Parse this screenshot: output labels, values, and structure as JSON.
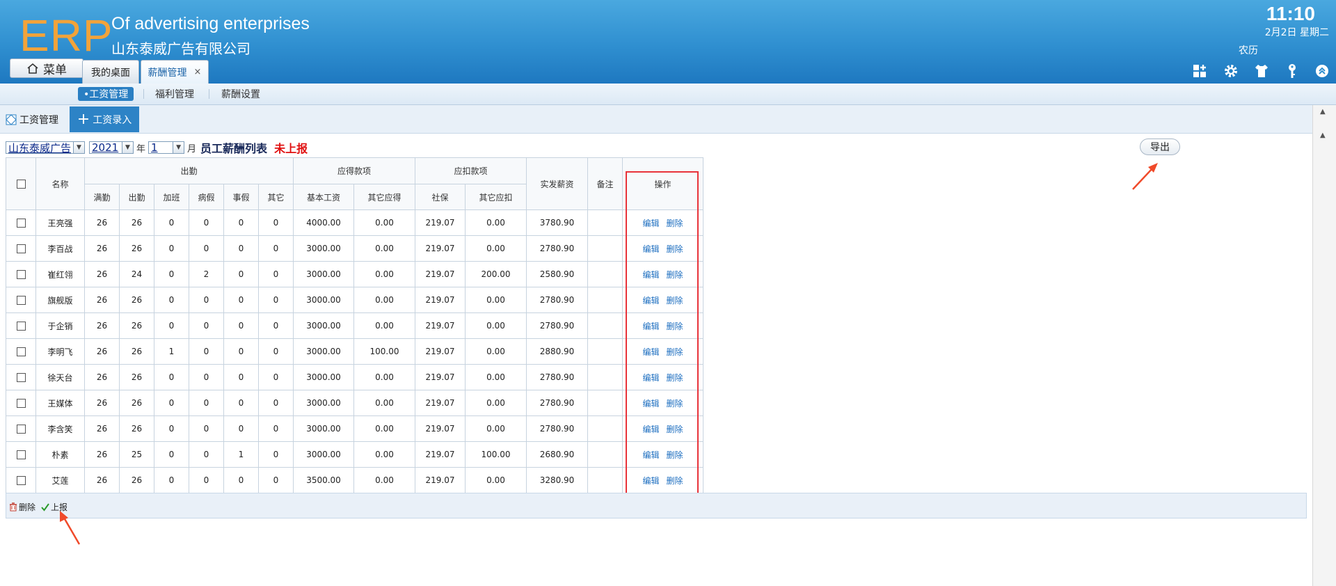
{
  "header": {
    "logo": "ERP",
    "company_en": "Of advertising enterprises",
    "company_cn": "山东泰威广告有限公司",
    "time": "11:10",
    "date": "2月2日 星期二",
    "lunar": "农历",
    "menu_label": "菜单",
    "tabs": [
      {
        "label": "我的桌面"
      },
      {
        "label": "薪酬管理",
        "close": "×"
      }
    ]
  },
  "subnav": {
    "items": [
      {
        "label": "•工资管理"
      },
      {
        "label": "福利管理"
      },
      {
        "label": "薪酬设置"
      }
    ]
  },
  "toolbar": {
    "title": "工资管理",
    "add_button": "工资录入"
  },
  "filter": {
    "company": "山东泰威广告",
    "year": "2021",
    "year_unit": "年",
    "month": "1",
    "month_unit": "月",
    "list_title": "员工薪酬列表",
    "status": "未上报",
    "export_button": "导出"
  },
  "table": {
    "headers": {
      "name": "名称",
      "attendance_group": "出勤",
      "payable_group": "应得款项",
      "deduction_group": "应扣款项",
      "net_pay": "实发薪资",
      "remark": "备注",
      "actions": "操作",
      "full_attendance": "满勤",
      "attendance": "出勤",
      "overtime": "加班",
      "sick_leave": "病假",
      "personal_leave": "事假",
      "other": "其它",
      "base_salary": "基本工资",
      "other_payable": "其它应得",
      "social_security": "社保",
      "other_deduction": "其它应扣"
    },
    "edit_label": "编辑",
    "delete_label": "删除",
    "rows": [
      {
        "name": "王亮强",
        "full": "26",
        "att": "26",
        "ot": "0",
        "sick": "0",
        "pers": "0",
        "other": "0",
        "base": "4000.00",
        "opay": "0.00",
        "ss": "219.07",
        "oded": "0.00",
        "net": "3780.90",
        "remark": ""
      },
      {
        "name": "李百战",
        "full": "26",
        "att": "26",
        "ot": "0",
        "sick": "0",
        "pers": "0",
        "other": "0",
        "base": "3000.00",
        "opay": "0.00",
        "ss": "219.07",
        "oded": "0.00",
        "net": "2780.90",
        "remark": ""
      },
      {
        "name": "崔红翎",
        "full": "26",
        "att": "24",
        "ot": "0",
        "sick": "2",
        "pers": "0",
        "other": "0",
        "base": "3000.00",
        "opay": "0.00",
        "ss": "219.07",
        "oded": "200.00",
        "net": "2580.90",
        "remark": ""
      },
      {
        "name": "旗舰版",
        "full": "26",
        "att": "26",
        "ot": "0",
        "sick": "0",
        "pers": "0",
        "other": "0",
        "base": "3000.00",
        "opay": "0.00",
        "ss": "219.07",
        "oded": "0.00",
        "net": "2780.90",
        "remark": ""
      },
      {
        "name": "于企销",
        "full": "26",
        "att": "26",
        "ot": "0",
        "sick": "0",
        "pers": "0",
        "other": "0",
        "base": "3000.00",
        "opay": "0.00",
        "ss": "219.07",
        "oded": "0.00",
        "net": "2780.90",
        "remark": ""
      },
      {
        "name": "李明飞",
        "full": "26",
        "att": "26",
        "ot": "1",
        "sick": "0",
        "pers": "0",
        "other": "0",
        "base": "3000.00",
        "opay": "100.00",
        "ss": "219.07",
        "oded": "0.00",
        "net": "2880.90",
        "remark": ""
      },
      {
        "name": "徐天台",
        "full": "26",
        "att": "26",
        "ot": "0",
        "sick": "0",
        "pers": "0",
        "other": "0",
        "base": "3000.00",
        "opay": "0.00",
        "ss": "219.07",
        "oded": "0.00",
        "net": "2780.90",
        "remark": ""
      },
      {
        "name": "王媒体",
        "full": "26",
        "att": "26",
        "ot": "0",
        "sick": "0",
        "pers": "0",
        "other": "0",
        "base": "3000.00",
        "opay": "0.00",
        "ss": "219.07",
        "oded": "0.00",
        "net": "2780.90",
        "remark": ""
      },
      {
        "name": "李含笑",
        "full": "26",
        "att": "26",
        "ot": "0",
        "sick": "0",
        "pers": "0",
        "other": "0",
        "base": "3000.00",
        "opay": "0.00",
        "ss": "219.07",
        "oded": "0.00",
        "net": "2780.90",
        "remark": ""
      },
      {
        "name": "朴素",
        "full": "26",
        "att": "25",
        "ot": "0",
        "sick": "0",
        "pers": "1",
        "other": "0",
        "base": "3000.00",
        "opay": "0.00",
        "ss": "219.07",
        "oded": "100.00",
        "net": "2680.90",
        "remark": ""
      },
      {
        "name": "艾莲",
        "full": "26",
        "att": "26",
        "ot": "0",
        "sick": "0",
        "pers": "0",
        "other": "0",
        "base": "3500.00",
        "opay": "0.00",
        "ss": "219.07",
        "oded": "0.00",
        "net": "3280.90",
        "remark": ""
      }
    ]
  },
  "footer": {
    "delete_label": "删除",
    "report_label": "上报"
  },
  "colors": {
    "header_blue": "#2f8fd0",
    "logo_orange": "#f2a33a",
    "accent_blue": "#2d83c6",
    "link_blue": "#1e6fc0",
    "status_red": "#e01010",
    "highlight_red": "#e8333a"
  }
}
